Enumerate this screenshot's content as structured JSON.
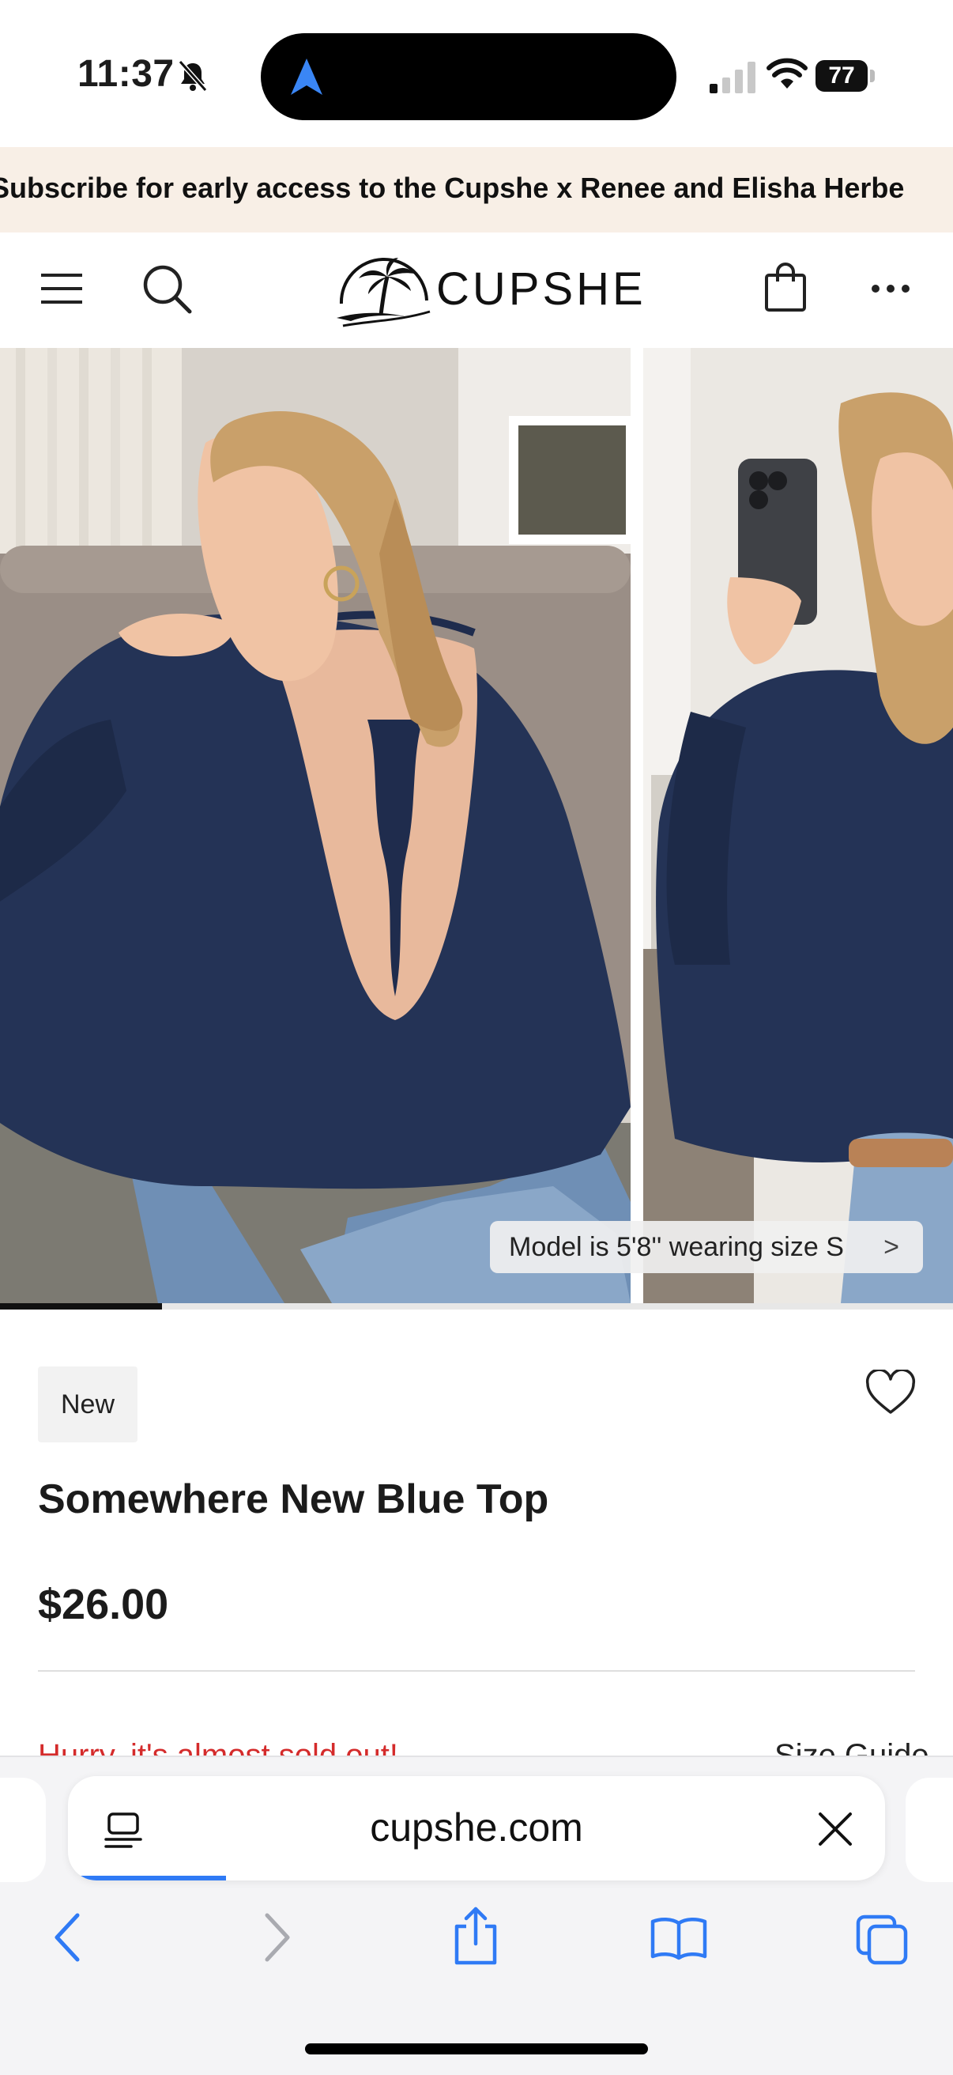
{
  "status_bar": {
    "time": "11:37",
    "battery": "77"
  },
  "announcement": {
    "text": "Subscribe for early access to the Cupshe x Renee and Elisha Herbe"
  },
  "header": {
    "brand": "CUPSHE"
  },
  "gallery": {
    "model_info": "Model is 5'8'' wearing size S",
    "chevron": ">",
    "position_fraction": 0.17
  },
  "product": {
    "badge": "New",
    "title": "Somewhere New Blue Top",
    "price": "$26.00",
    "stock_notice": "Hurry, it's almost sold out!",
    "size_guide": "Size Guide"
  },
  "browser": {
    "url": "cupshe.com"
  },
  "colors": {
    "accent_blue": "#2f7af5",
    "sold_out_red": "#d42b2b",
    "navy_top": "#243356",
    "banner_bg": "#f8efe6"
  }
}
